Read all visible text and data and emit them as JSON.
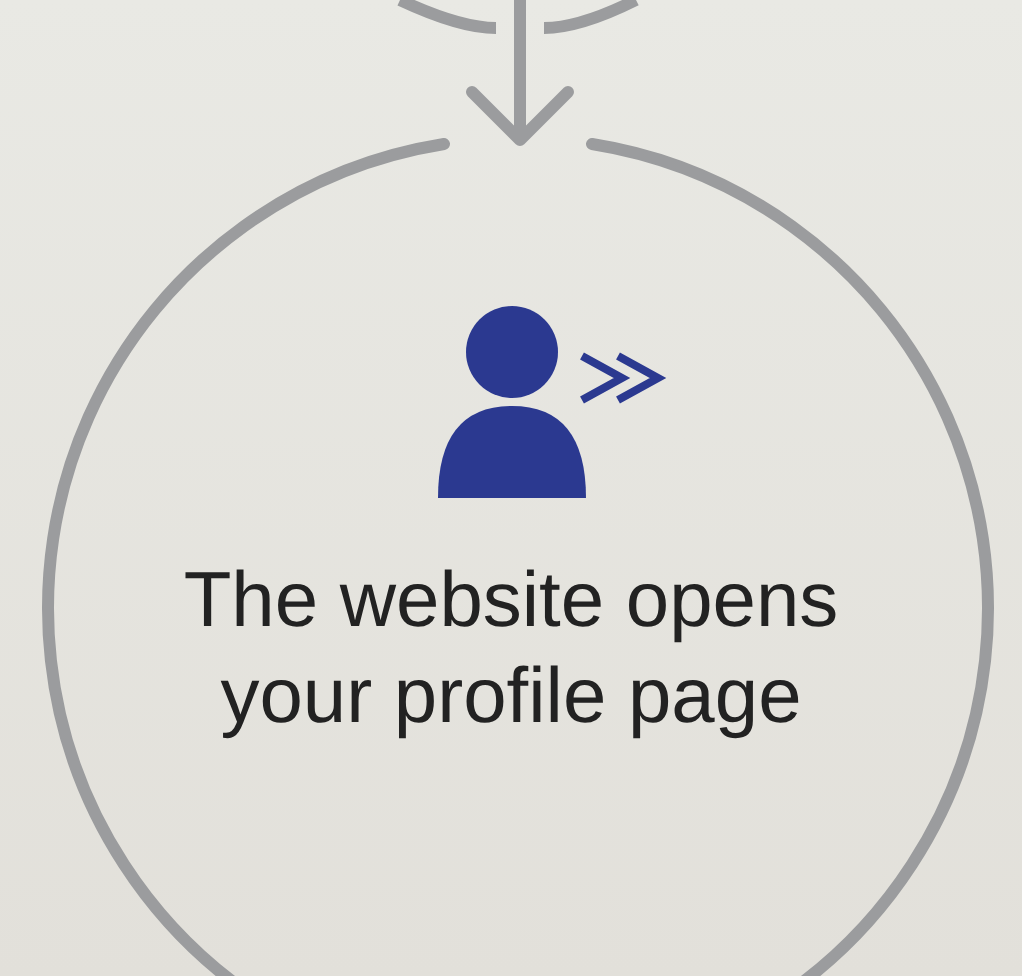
{
  "step": {
    "text_lines": [
      "The website opens",
      "your profile page"
    ]
  }
}
